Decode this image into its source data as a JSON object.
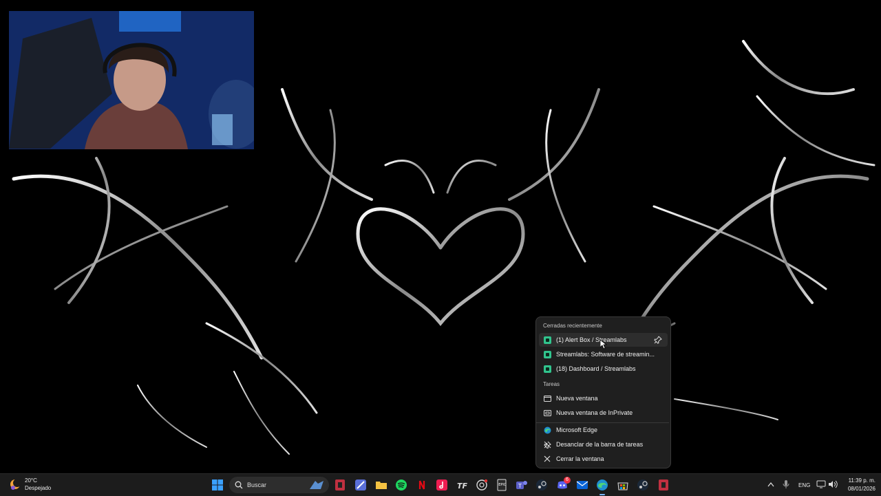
{
  "jumplist": {
    "recent_header": "Cerradas recientemente",
    "recent": [
      {
        "label": "(1) Alert Box / Streamlabs"
      },
      {
        "label": "Streamlabs: Software de streamin..."
      },
      {
        "label": "(18) Dashboard / Streamlabs"
      }
    ],
    "tasks_header": "Tareas",
    "tasks": [
      {
        "label": "Nueva ventana"
      },
      {
        "label": "Nueva ventana de InPrivate"
      }
    ],
    "app_actions": [
      {
        "label": "Microsoft Edge"
      },
      {
        "label": "Desanclar de la barra de tareas"
      },
      {
        "label": "Cerrar la ventana"
      }
    ]
  },
  "taskbar": {
    "weather_temp": "20°C",
    "weather_desc": "Despejado",
    "search_label": "Buscar",
    "language": "ENG",
    "time": "11:39 p. m.",
    "date": "08/01/2026",
    "badges": {
      "discord": "6"
    }
  },
  "colors": {
    "accent": "#7ab7ff",
    "streamlabs_green": "#31c48d",
    "menu_bg": "#1f1f1f"
  }
}
